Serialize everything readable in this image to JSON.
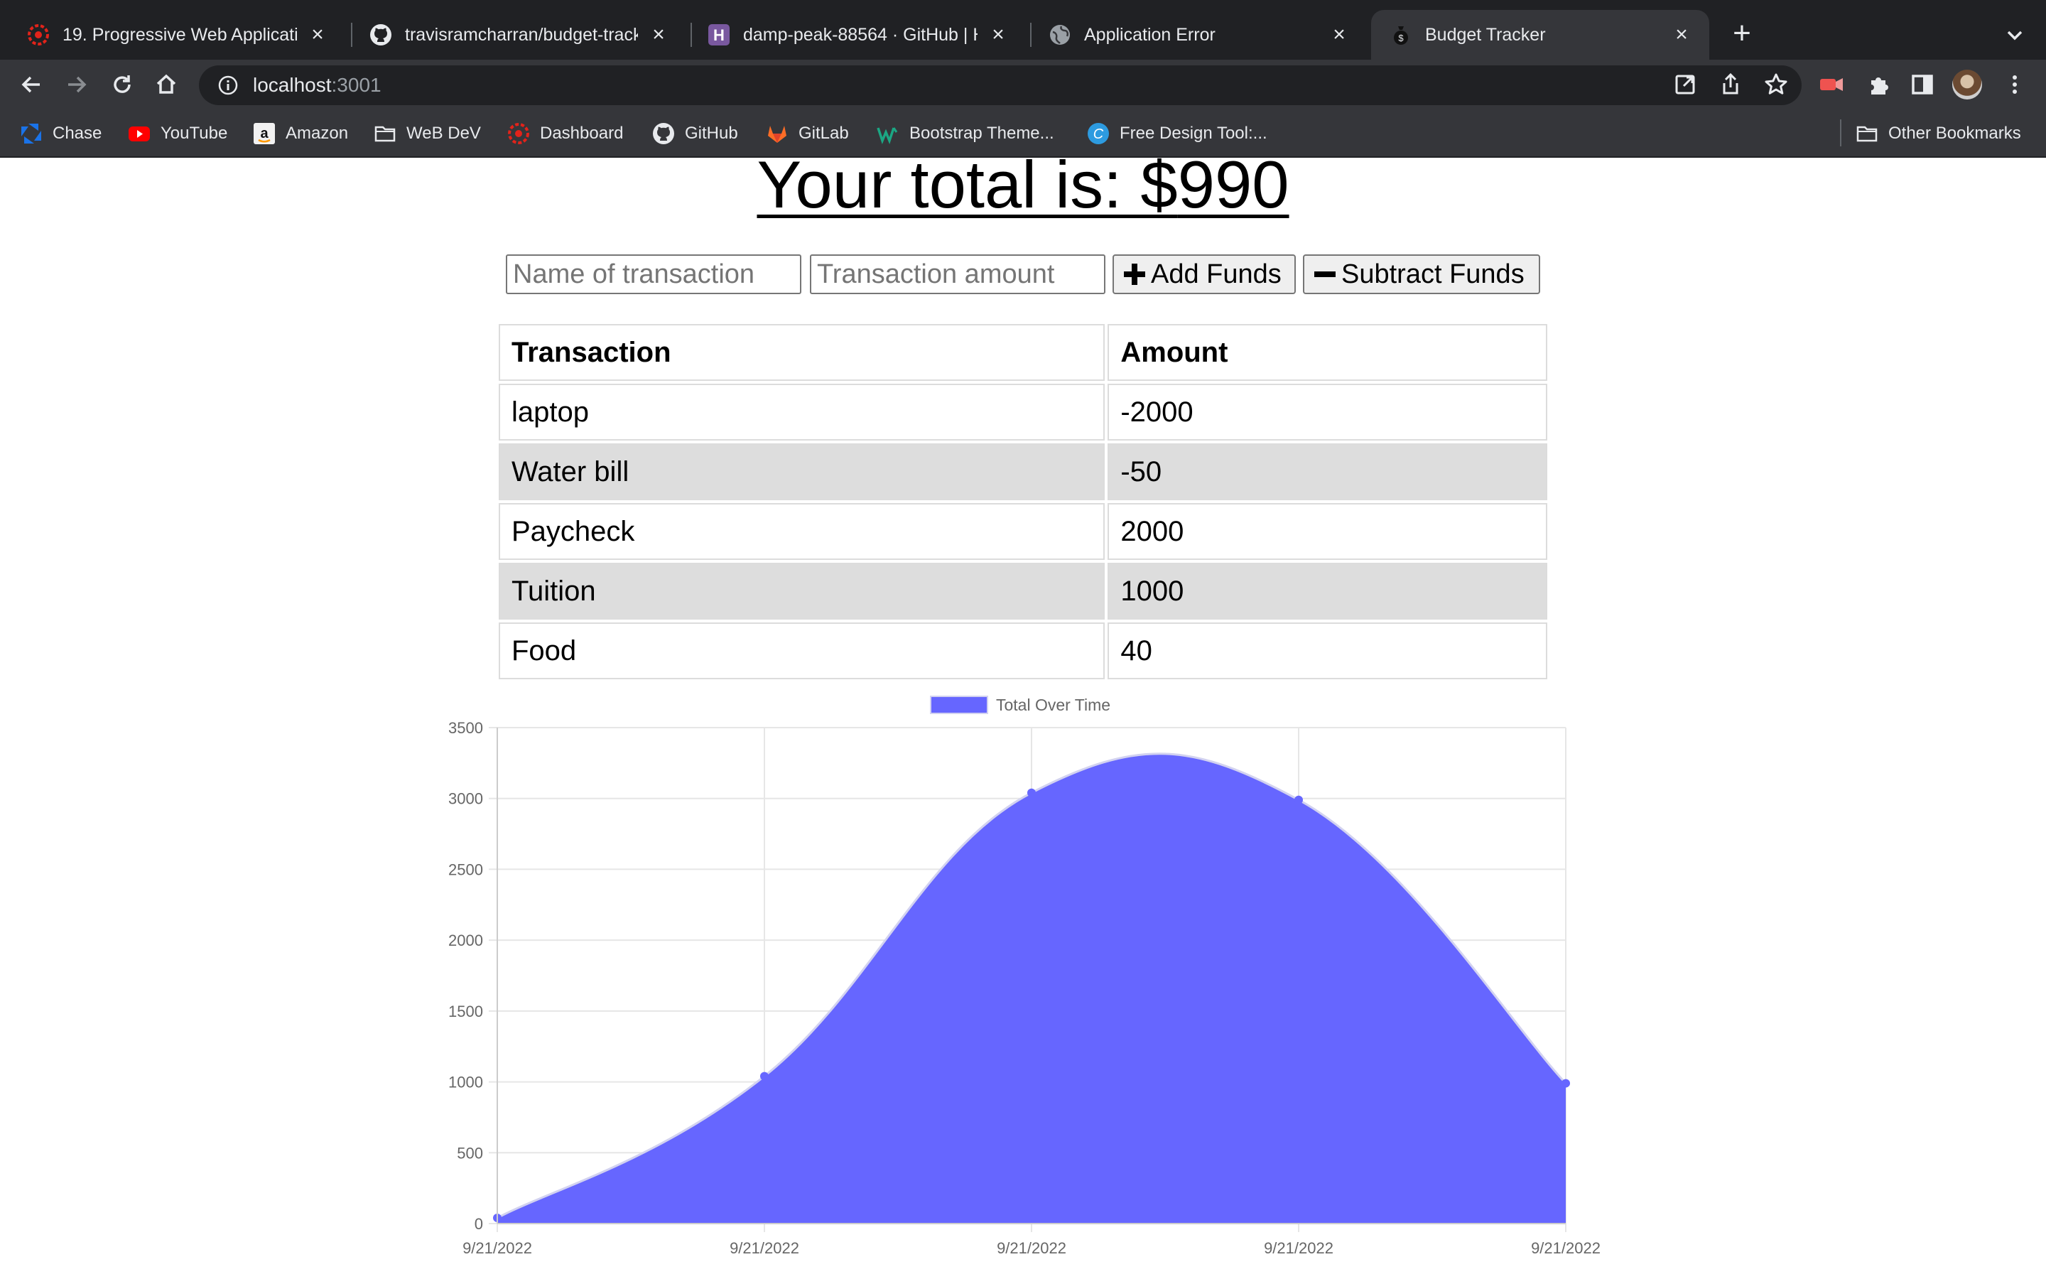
{
  "browser": {
    "tabs": [
      {
        "title": "19. Progressive Web Applicatio",
        "icon": "bootcamp-icon"
      },
      {
        "title": "travisramcharran/budget-track",
        "icon": "github-icon"
      },
      {
        "title": "damp-peak-88564 · GitHub | H",
        "icon": "heroku-icon"
      },
      {
        "title": "Application Error",
        "icon": "globe-icon"
      },
      {
        "title": "Budget Tracker",
        "icon": "money-bag-icon"
      }
    ],
    "url": {
      "host": "localhost",
      "port": ":3001"
    },
    "bookmarks": [
      {
        "label": "Chase",
        "icon": "chase-icon"
      },
      {
        "label": "YouTube",
        "icon": "youtube-icon"
      },
      {
        "label": "Amazon",
        "icon": "amazon-icon"
      },
      {
        "label": "WeB DeV",
        "icon": "folder-icon"
      },
      {
        "label": "Dashboard",
        "icon": "bootcamp-icon"
      },
      {
        "label": "GitHub",
        "icon": "github-icon"
      },
      {
        "label": "GitLab",
        "icon": "gitlab-icon"
      },
      {
        "label": "Bootstrap Theme...",
        "icon": "wrapbootstrap-icon"
      },
      {
        "label": "Free Design Tool:...",
        "icon": "canva-icon"
      }
    ],
    "other_bookmarks": "Other Bookmarks"
  },
  "page": {
    "total_label": "Your total is: $",
    "total_value": "990",
    "form": {
      "name_placeholder": "Name of transaction",
      "amount_placeholder": "Transaction amount",
      "add_label": "Add Funds",
      "subtract_label": "Subtract Funds"
    },
    "table": {
      "headers": [
        "Transaction",
        "Amount"
      ],
      "rows": [
        {
          "name": "laptop",
          "amount": "-2000"
        },
        {
          "name": "Water bill",
          "amount": "-50"
        },
        {
          "name": "Paycheck",
          "amount": "2000"
        },
        {
          "name": "Tuition",
          "amount": "1000"
        },
        {
          "name": "Food",
          "amount": "40"
        }
      ]
    }
  },
  "chart_data": {
    "type": "area",
    "legend": [
      "Total Over Time"
    ],
    "legend_position": "top",
    "x": [
      "9/21/2022",
      "9/21/2022",
      "9/21/2022",
      "9/21/2022",
      "9/21/2022"
    ],
    "series": [
      {
        "name": "Total Over Time",
        "values": [
          40,
          1040,
          3040,
          2990,
          990
        ]
      }
    ],
    "ylim": [
      0,
      3500
    ],
    "yticks": [
      "0",
      "500",
      "1000",
      "1500",
      "2000",
      "2500",
      "3000",
      "3500"
    ],
    "grid": true,
    "colors": {
      "fill": "#6666ff",
      "line": "#d2d2f0",
      "grid": "#e6e6e6",
      "tick": "#666666"
    }
  }
}
